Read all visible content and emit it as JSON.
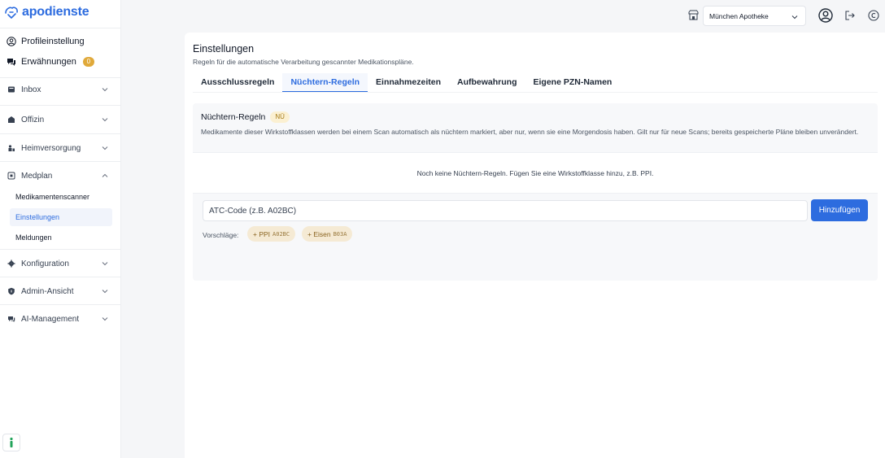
{
  "app": {
    "brand": "apodienste",
    "brand_color": "#2d6cdf"
  },
  "sidebar": {
    "profile_label": "Profileinstellung",
    "mentions_label": "Erwähnungen",
    "mentions_count": "0",
    "items": [
      {
        "label": "Inbox",
        "icon": "inbox-icon"
      },
      {
        "label": "Offizin",
        "icon": "offizin-icon"
      },
      {
        "label": "Heimversorgung",
        "icon": "heimversorgung-icon"
      },
      {
        "label": "Medplan",
        "icon": "medplan-icon",
        "expanded": true
      },
      {
        "label": "Konfiguration",
        "icon": "gear-icon"
      },
      {
        "label": "Admin-Ansicht",
        "icon": "shield-icon"
      },
      {
        "label": "AI-Management",
        "icon": "ai-icon"
      }
    ],
    "medplan_sub": [
      {
        "label": "Medikamentenscanner"
      },
      {
        "label": "Einstellungen",
        "active": true
      },
      {
        "label": "Meldungen"
      }
    ]
  },
  "topbar": {
    "store_selected": "München Apotheke"
  },
  "main": {
    "title": "Einstellungen",
    "subtitle": "Regeln für die automatische Verarbeitung gescannter Medikationspläne.",
    "tabs": [
      {
        "label": "Ausschlussregeln"
      },
      {
        "label": "Nüchtern-Regeln",
        "active": true
      },
      {
        "label": "Einnahmezeiten"
      },
      {
        "label": "Aufbewahrung"
      },
      {
        "label": "Eigene PZN-Namen"
      }
    ],
    "panel": {
      "title": "Nüchtern-Regeln",
      "badge": "NÜ",
      "description": "Medikamente dieser Wirkstoffklassen werden bei einem Scan automatisch als nüchtern markiert, aber nur, wenn sie eine Morgendosis haben. Gilt nur für neue Scans; bereits gespeicherte Pläne bleiben unverändert.",
      "empty_text": "Noch keine Nüchtern-Regeln. Fügen Sie eine Wirkstoffklasse hinzu, z.B. PPI.",
      "input_placeholder": "ATC-Code (z.B. A02BC)",
      "add_button": "Hinzufügen",
      "suggestions_label": "Vorschläge:",
      "suggestions": [
        {
          "label": "+ PPI",
          "code": "A02BC"
        },
        {
          "label": "+ Eisen",
          "code": "B03A"
        }
      ]
    }
  }
}
